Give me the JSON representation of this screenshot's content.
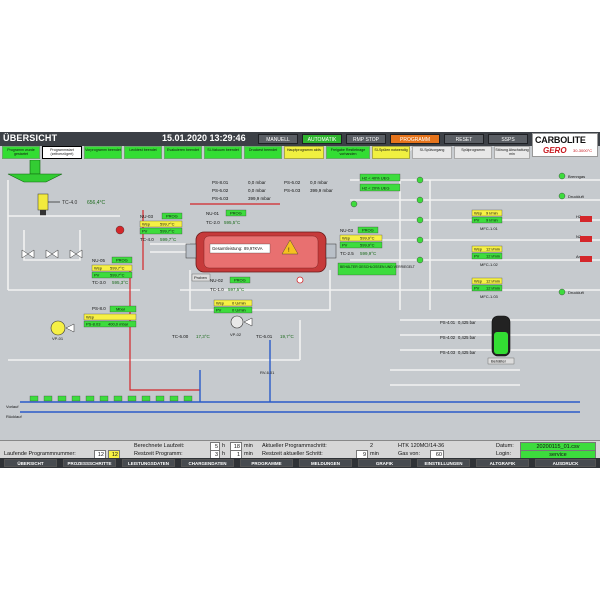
{
  "header": {
    "title": "ÜBERSICHT",
    "datetime": "15.01.2020 13:29:46",
    "modes": [
      {
        "label": "MANUELL",
        "color": "#5a5e64"
      },
      {
        "label": "AUTOMATIK",
        "color": "#2fb52f"
      },
      {
        "label": "RMP STOP",
        "color": "#5a5e64"
      },
      {
        "label": "PROGRAMM ONLINE",
        "color": "#e6741c"
      },
      {
        "label": "RESET",
        "color": "#5a5e64"
      },
      {
        "label": "SSPS",
        "color": "#5a5e64"
      }
    ],
    "logo_line1": "CARBOLITE",
    "logo_line2": "GERO",
    "logo_line3": "30-3000°C"
  },
  "steps": [
    {
      "label": "Programm wurde gestartet",
      "state": "green"
    },
    {
      "label": "Programmstart (zeitverzögert)",
      "state": "sel"
    },
    {
      "label": "Vorprogramm beendet",
      "state": "green"
    },
    {
      "label": "Lecktest beendet",
      "state": "green"
    },
    {
      "label": "Evakuieren beendet",
      "state": "green"
    },
    {
      "label": "SI-Vakuum beendet",
      "state": "green"
    },
    {
      "label": "Druckest beendet",
      "state": "green"
    },
    {
      "label": "Hauptprogramm aktiv",
      "state": "yellow"
    },
    {
      "label": "Freigabe Restlebrage vorhanden",
      "state": "green"
    },
    {
      "label": "SI-Spülen notwendig",
      "state": "yellow"
    },
    {
      "label": "SI-Spülvorgang",
      "state": "dim"
    },
    {
      "label": "Spülprogramm",
      "state": "dim"
    },
    {
      "label": "Störung Abschaltung min",
      "state": "dim"
    }
  ],
  "process": {
    "tc40": "TC-4.0",
    "tc40_val": "656,4°C",
    "nu03": "NU-03",
    "prog": "PROG",
    "wsp": "Wsp",
    "pv": "PV",
    "nu03_wsp": "599,7°C",
    "nu03_pv": "599,7°C",
    "tc40b": "TC-4.0",
    "tc40b_val": "599,7°C",
    "nu05": "NU-05",
    "nu05_wsp": "599,7°C",
    "nu05_pv": "599,7°C",
    "tc30": "TC-3.0",
    "tc30_val": "595,3°C",
    "ps80": "PS-8.0",
    "ps80_val": "Mbar",
    "ps03": "PS-8.03",
    "ps03_val": "400,0 mbar",
    "ps01": "PS-8.01",
    "ps01_val": "0,0 mbar",
    "ps02": "PS-6.02",
    "ps02_val": "0,0 mbar",
    "ps63": "PS-6.03",
    "ps63_val": "399,9 mbar",
    "h2a": "H2 < 40% UEG",
    "h2b": "H2 < 20% UEG",
    "nu01": "NU-01",
    "nu01_val": "595,3°C",
    "tc20": "TC-2.0",
    "tc20_val": "595,5°C",
    "gesamt_label": "Gesamtleistung:",
    "gesamt_val": "89,97KVA",
    "nu02": "NU-02",
    "nu02_val": "595,5°C",
    "tc10": "TC-1.0",
    "tc10_val": "597,5°C",
    "proben": "Proben",
    "nu03b": "NU-03",
    "nu03b_val": "599,9°C",
    "tc25": "TC-2.5",
    "tc25_val": "599,9°C",
    "behaelter": "BEHÄLTER GESCHLOSSEN UND VERRIEGELT",
    "vp_wsp": "0 U/min",
    "vp_pv": "0 U/min",
    "tc600": "TC-6.00",
    "tc600_val": "17,3°C",
    "tc601": "TC-6.01",
    "tc601_val": "19,7°C",
    "vp01": "VP-01",
    "vp02": "VP-02",
    "flows": [
      {
        "label": "MFC-1.01",
        "wsp": "9 l/min",
        "pv": "9 l/min"
      },
      {
        "label": "MFC-1.02",
        "wsp": "12 l/min",
        "pv": "12 l/min"
      },
      {
        "label": "MFC-1.03",
        "wsp": "12 l/min",
        "pv": "12 l/min"
      }
    ],
    "exhaust_labels": [
      "Brenngas",
      "Druckluft",
      "H2",
      "N2",
      "Ar",
      "Druckluft"
    ],
    "hx": [
      {
        "label": "PS-4.01",
        "val": "0,425 bar"
      },
      {
        "label": "PS-4.02",
        "val": "0,425 bar"
      },
      {
        "label": "PS-4.03",
        "val": "0,425 bar"
      }
    ],
    "tank_label": "Behälter",
    "vorlauf": "Vorlauf",
    "ruecklauf": "Rücklauf",
    "rv_label": "RV-6.01"
  },
  "info": {
    "berechnete_laufzeit": "Berechnete Laufzeit:",
    "bl_d": "5",
    "bl_h": "18",
    "bl_m": "min",
    "restzeit": "Restzeit Programm:",
    "rz_d": "3",
    "rz_h": "1",
    "rz_m": "min",
    "aktueller_schritt": "Aktueller Programmschritt:",
    "as_val": "2",
    "restzeit_schritt": "Restzeit aktueller Schritt:",
    "rs_val": "9",
    "rs_unit": "min",
    "programm": "HTK 120MO/14-36",
    "datum_label": "Datum:",
    "datum_val": "20200115_01.csv",
    "ausgeloest_label": "Gas von:",
    "ausgeloest_val": "60",
    "login_label": "Login:",
    "login_val": "service",
    "laufende_label": "Laufende Programmnummer:",
    "laufende_a": "12",
    "laufende_b": "12"
  },
  "nav": [
    "ÜBERSICHT",
    "PROZESSSCHRITTE",
    "LEISTUNGSDATEN",
    "CHARGENDATEN",
    "PROGRAMME",
    "MELDUNGEN",
    "GRAFIK",
    "EINSTELLUNGEN",
    "ALTGRAFIK",
    "AUSDRUCK"
  ]
}
